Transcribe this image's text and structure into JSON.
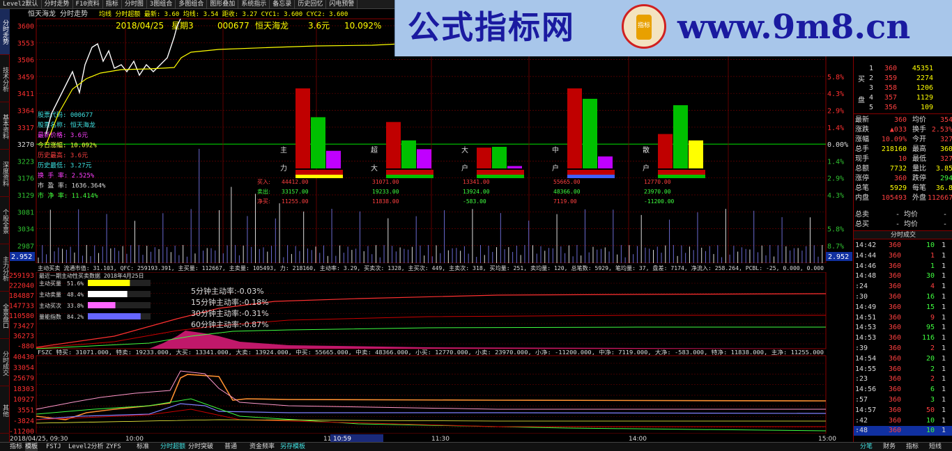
{
  "toolbar": [
    "Level2默认",
    "分时走势",
    "F10资料",
    "指标",
    "分时图",
    "3图组合",
    "多图组合",
    "图形叠加",
    "系统指示",
    "备忘录",
    "历史回忆",
    "闪电预警"
  ],
  "sidebar_tabs": [
    "分时走势",
    "技术分析",
    "基本资料",
    "深度资料",
    "个股全景",
    "主力分析",
    "全景盘口",
    "分时成交",
    "其他"
  ],
  "top": {
    "stock_line": "恒天海龙 分时走势",
    "ind_line": "均线  分时超额  最新: 3.60  均线: 3.54  距收: 3.27  CYC1: 3.600  CYC2: 3.600",
    "date": "2018/04/25",
    "weekday": "星期3",
    "code": "000677",
    "name": "恒天海龙",
    "price": "3.6元",
    "pct": "10.092%"
  },
  "y_prices": [
    "3600",
    "3553",
    "3506",
    "3459",
    "3411",
    "3364",
    "3317",
    "3270",
    "3223",
    "3176",
    "3129",
    "3081",
    "3034",
    "2987"
  ],
  "y_pcts": [
    "5.8%",
    "4.3%",
    "2.9%",
    "1.4%",
    "0.00%",
    "1.4%",
    "2.9%",
    "4.3%",
    "5.8%",
    "8.7%"
  ],
  "cur_price_tag": "2.952",
  "info_lines": [
    "股票代码: 000677",
    "股票名称: 恒天海龙",
    "最新价格: 3.6元",
    "今日涨幅: 10.092%",
    "历史最高: 3.6元",
    "历史最低: 3.27元",
    "换 手 率: 2.525%",
    "市 盈 率: 1636.364%",
    "市 净 率: 11.414%"
  ],
  "flow": {
    "group_labels": [
      [
        "主",
        "力"
      ],
      [
        "超",
        "大"
      ],
      [
        "大",
        "户"
      ],
      [
        "中",
        "户"
      ],
      [
        "散",
        "户"
      ]
    ],
    "row_labels": [
      "买入:",
      "卖出:",
      "净买:"
    ],
    "buy": [
      "44412.00",
      "31071.00",
      "13341.00",
      "55665.00",
      "12770.00"
    ],
    "sell": [
      "33157.00",
      "19233.00",
      "13924.00",
      "48366.00",
      "23970.00"
    ],
    "net": [
      "11255.00",
      "11838.00",
      "-583.00",
      "7119.00",
      "-11200.00"
    ],
    "bars": [
      [
        1.0,
        0.64,
        0.22
      ],
      [
        0.58,
        0.35,
        0.24
      ],
      [
        0.26,
        0.27,
        0.03
      ],
      [
        1.0,
        0.87,
        0.15
      ],
      [
        0.43,
        0.79,
        0.35
      ]
    ]
  },
  "mid_line": "主动买卖  流通市值: 31.103, QFC: 259193.391, 主买量: 112667, 主卖量: 105493, 力: 218160, 主动率: 3.29, 买卖次: 1328, 主买次: 449, 主卖次: 318, 买均量: 251, 卖均量: 120, 总笔数: 5929, 笔均量: 37, 盘差: 7174, 净流入: 258.264, PCBL: -25, 0.000, 0.000",
  "mid_y": [
    "259193",
    "222040",
    "184887",
    "147733",
    "110580",
    "73427",
    "36273",
    "-880"
  ],
  "mid_title": "最近一期主动性买卖数据 2018年4月25日",
  "mid_stats": [
    {
      "label": "主动买量",
      "val": "51.6%",
      "frac": 0.516,
      "color": "#ffff00"
    },
    {
      "label": "主动卖量",
      "val": "48.4%",
      "frac": 0.484,
      "color": "#ffffff"
    },
    {
      "label": "主动买次",
      "val": "33.8%",
      "frac": 0.338,
      "color": "#ff66ff"
    },
    {
      "label": "量能指数",
      "val": "84.2%",
      "frac": 0.842,
      "color": "#6666ff"
    }
  ],
  "mid_rates": [
    "5分钟主动率:-0.03%",
    "15分钟主动率:-0.18%",
    "30分钟主动率:-0.31%",
    "60分钟主动率:-0.87%"
  ],
  "low_line": "FSZC  特买: 31071.000, 特卖: 19233.000, 大买: 13341.000, 大卖: 13924.000, 中买: 55665.000, 中卖: 48366.000, 小买: 12770.000, 小卖: 23970.000, 小净: -11200.000, 中净: 7119.000, 大净: -583.000, 特净: 11838.000, 主净: 11255.000",
  "low_y": [
    "40430",
    "33054",
    "25679",
    "18303",
    "10927",
    "3551",
    "-3824",
    "-11200"
  ],
  "x_labels": [
    "2018/04/25, 09:30",
    "10:00",
    "11:30",
    "14:00",
    "15:00"
  ],
  "x_cursor": "10:59",
  "x_extra": "11",
  "bottom_tabs": [
    "指标",
    "模板",
    "FSTJ",
    "Level2分析",
    "ZYFS",
    "标准",
    "分时超额",
    "分时突破",
    "普通",
    "资金频率",
    "另存模板"
  ],
  "quote": {
    "sell_rows": [
      [
        "1",
        "",
        ""
      ],
      [
        "2",
        "",
        ""
      ],
      [
        "3",
        "",
        ""
      ],
      [
        "4",
        "",
        ""
      ],
      [
        "5",
        "",
        ""
      ]
    ],
    "buy_side_label": [
      "买",
      "盘"
    ],
    "buy_rows": [
      [
        "1",
        "360",
        "45351"
      ],
      [
        "2",
        "359",
        "2274"
      ],
      [
        "3",
        "358",
        "1206"
      ],
      [
        "4",
        "357",
        "1129"
      ],
      [
        "5",
        "356",
        "109"
      ]
    ],
    "stats": [
      [
        "最新",
        "360",
        "均价",
        "354"
      ],
      [
        "涨跌",
        "▲033",
        "换手",
        "2.53%"
      ],
      [
        "涨幅",
        "10.09%",
        "今开",
        "327"
      ],
      [
        "总手",
        "218160",
        "最高",
        "360"
      ],
      [
        "现手",
        "10",
        "最低",
        "327"
      ],
      [
        "总额",
        "7732",
        "量比",
        "3.85"
      ],
      [
        "涨停",
        "360",
        "跌停",
        "294"
      ],
      [
        "总笔",
        "5929",
        "每笔",
        "36.8"
      ],
      [
        "内盘",
        "105493",
        "外盘",
        "112667"
      ]
    ],
    "totals": [
      [
        "总卖",
        "- 均价",
        "-"
      ],
      [
        "总买",
        "- 均价",
        "-"
      ]
    ],
    "trades_header": "分时成交",
    "trades": [
      [
        "14:42",
        "360",
        "10",
        "1"
      ],
      [
        "14:44",
        "360",
        "1",
        "1"
      ],
      [
        "14:46",
        "360",
        "1",
        "1"
      ],
      [
        "14:48",
        "360",
        "30",
        "1"
      ],
      [
        ":24",
        "360",
        "4",
        "1"
      ],
      [
        ":30",
        "360",
        "16",
        "1"
      ],
      [
        "14:49",
        "360",
        "15",
        "1"
      ],
      [
        "14:51",
        "360",
        "9",
        "1"
      ],
      [
        "14:53",
        "360",
        "95",
        "1"
      ],
      [
        "14:53",
        "360",
        "116",
        "1"
      ],
      [
        ":39",
        "360",
        "2",
        "1"
      ],
      [
        "14:54",
        "360",
        "20",
        "1"
      ],
      [
        "14:55",
        "360",
        "2",
        "1"
      ],
      [
        ":23",
        "360",
        "2",
        "1"
      ],
      [
        "14:56",
        "360",
        "6",
        "1"
      ],
      [
        ":57",
        "360",
        "3",
        "1"
      ],
      [
        "14:57",
        "360",
        "50",
        "1"
      ],
      [
        ":42",
        "360",
        "10",
        "1"
      ],
      [
        ":48",
        "360",
        "10",
        "1"
      ]
    ],
    "bottom_tabs": [
      "分笔",
      "财务",
      "指标",
      "短线"
    ]
  },
  "watermark": {
    "title": "公式指标网",
    "url": "www.9m8.cn",
    "logo_text": "指标"
  }
}
